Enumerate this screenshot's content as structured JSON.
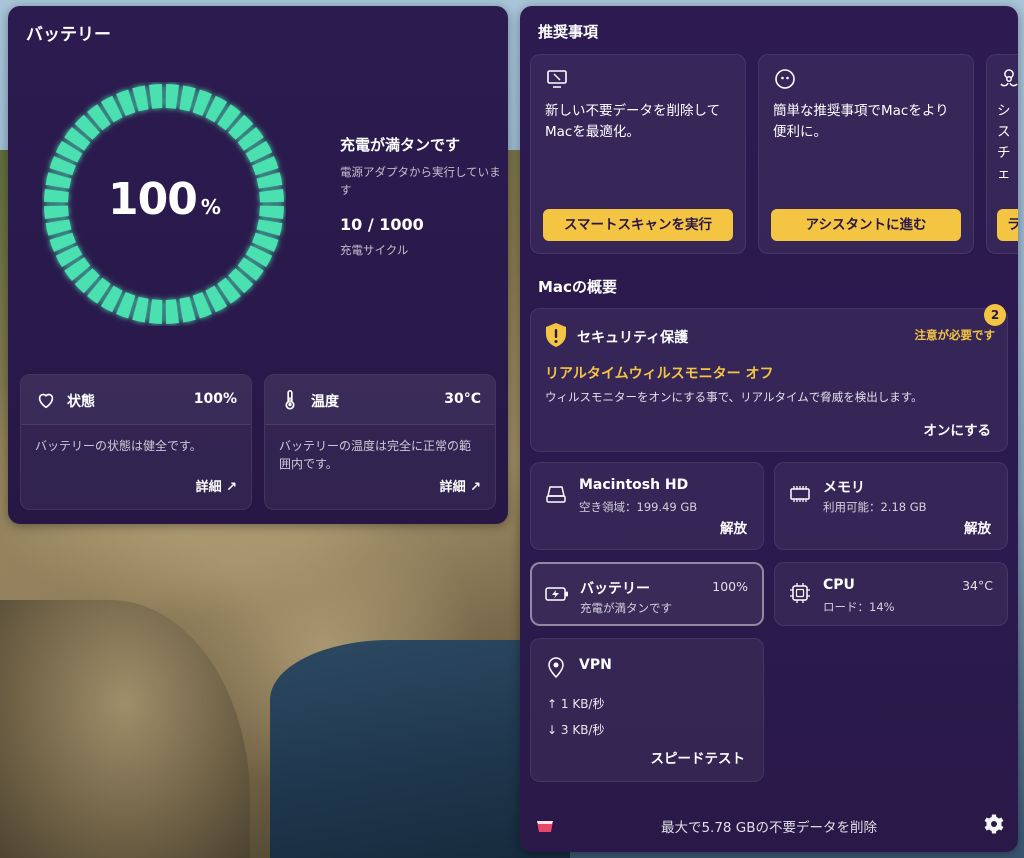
{
  "battery_panel": {
    "title": "バッテリー",
    "percent": "100",
    "percent_unit": "%",
    "charge_level": 1.0,
    "status_title": "充電が満タンです",
    "status_sub": "電源アダプタから実行しています",
    "cycles": "10 / 1000",
    "cycles_label": "充電サイクル",
    "ring_color": "#4be0b0",
    "health": {
      "label": "状態",
      "value": "100%",
      "desc": "バッテリーの状態は健全です。",
      "more": "詳細 ↗",
      "icon": "heart-icon"
    },
    "temperature": {
      "label": "温度",
      "value": "30°C",
      "desc": "バッテリーの温度は完全に正常の範囲内です。",
      "more": "詳細 ↗",
      "icon": "thermometer-icon"
    }
  },
  "recommendations": {
    "title": "推奨事項",
    "cards": [
      {
        "text": "新しい不要データを削除してMacを最適化。",
        "button": "スマートスキャンを実行",
        "icon": "monitor-icon"
      },
      {
        "text": "簡単な推奨事項でMacをより便利に。",
        "button": "アシスタントに進む",
        "icon": "assistant-icon"
      },
      {
        "text": "シスチェ",
        "button": "ラ",
        "icon": "biohazard-icon"
      }
    ]
  },
  "overview": {
    "title": "Macの概要",
    "security": {
      "title": "セキュリティ保護",
      "warning": "注意が必要です",
      "badge": "2",
      "monitor": "リアルタイムウィルスモニター オフ",
      "desc": "ウィルスモニターをオンにする事で、リアルタイムで脅威を検出します。",
      "action": "オンにする",
      "accent": "#f4c542"
    },
    "disk": {
      "name": "Macintosh HD",
      "sub": "空き領域：199.49 GB",
      "action": "解放",
      "icon": "disk-icon"
    },
    "memory": {
      "name": "メモリ",
      "sub": "利用可能：2.18 GB",
      "action": "解放",
      "icon": "memory-icon"
    },
    "battery": {
      "name": "バッテリー",
      "sub": "充電が満タンです",
      "value": "100%",
      "icon": "battery-icon"
    },
    "cpu": {
      "name": "CPU",
      "sub": "ロード：14%",
      "value": "34°C",
      "icon": "cpu-icon"
    },
    "vpn": {
      "name": "VPN",
      "up": "1 KB/秒",
      "down": "3 KB/秒",
      "action": "スピードテスト",
      "icon": "vpn-pin-icon"
    }
  },
  "footer": {
    "text": "最大で5.78 GBの不要データを削除",
    "icon_left": "cleanmymac-logo-icon",
    "icon_right": "gear-icon"
  }
}
